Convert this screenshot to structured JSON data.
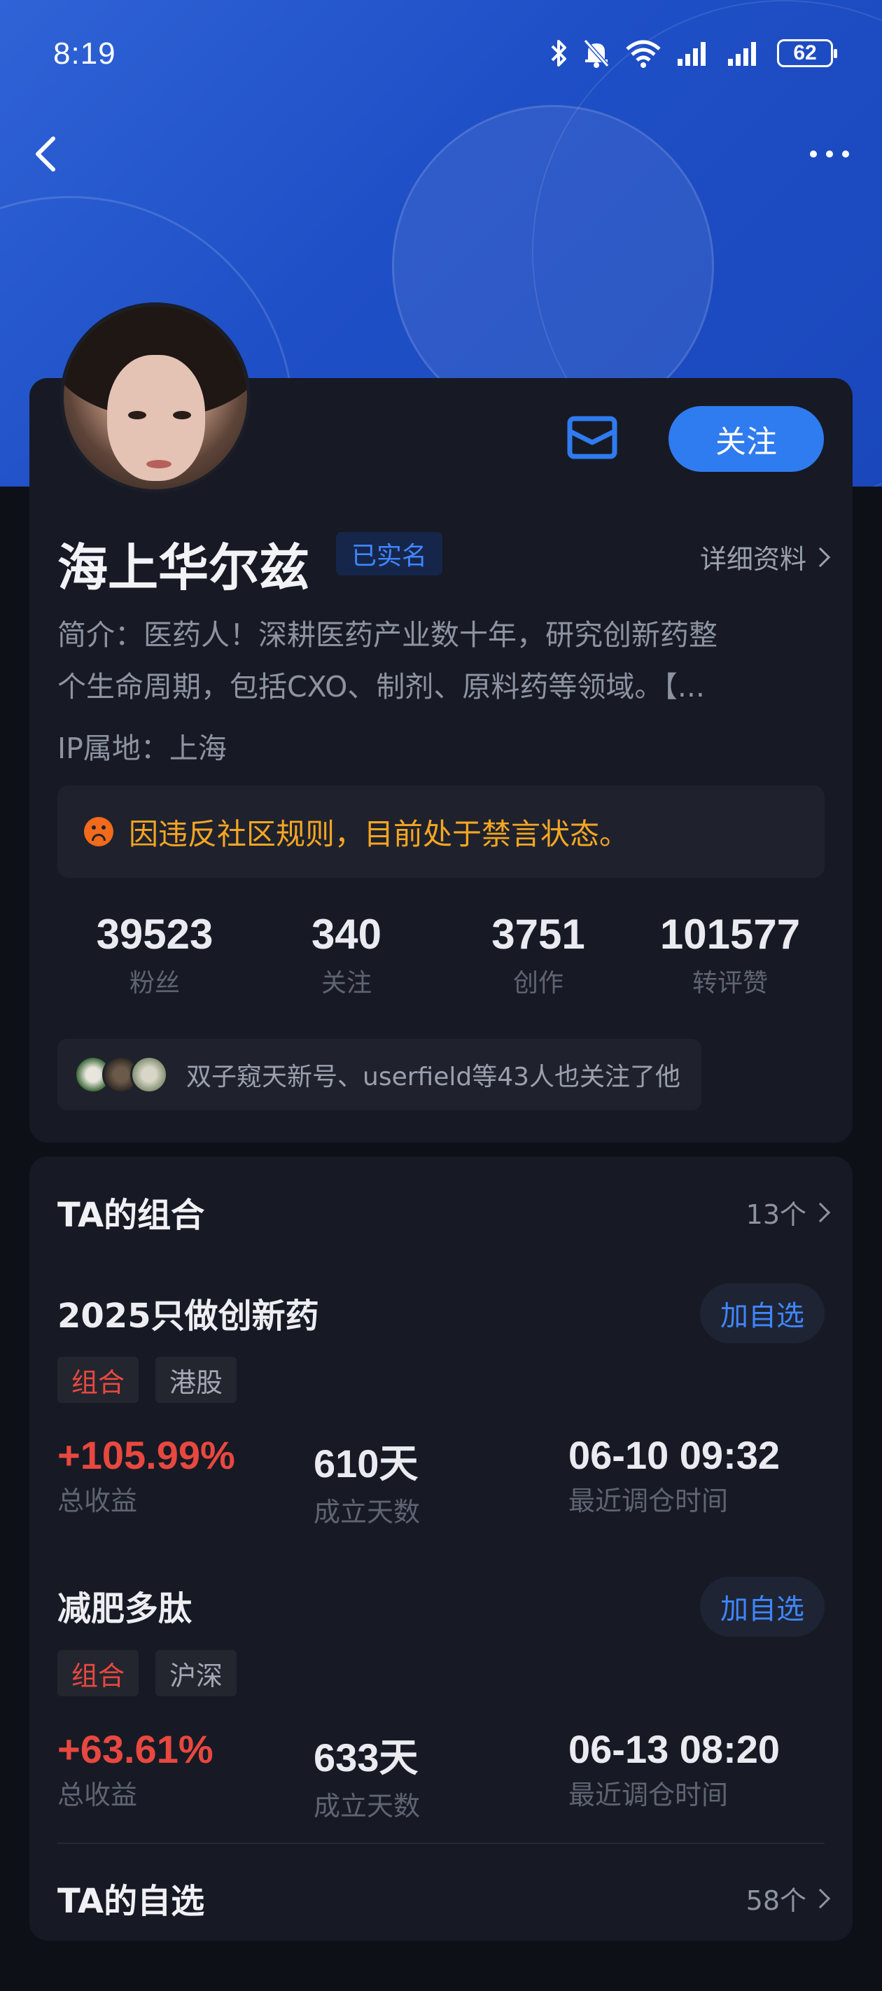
{
  "status_bar": {
    "time": "8:19",
    "battery": "62"
  },
  "profile": {
    "name": "海上华尔兹",
    "verified_badge": "已实名",
    "detail_link": "详细资料",
    "follow_button": "关注",
    "bio_line1": "简介：医药人！深耕医药产业数十年，研究创新药整",
    "bio_line2": "个生命周期，包括CXO、制剂、原料药等领域。【...",
    "ip_location": "IP属地：上海",
    "ban_notice": "因违反社区规则，目前处于禁言状态。",
    "stats": [
      {
        "value": "39523",
        "label": "粉丝"
      },
      {
        "value": "340",
        "label": "关注"
      },
      {
        "value": "3751",
        "label": "创作"
      },
      {
        "value": "101577",
        "label": "转评赞"
      }
    ],
    "mutual_follow_text": "双子窥天新号、userfield等43人也关注了他"
  },
  "portfolios": {
    "section_title": "TA的组合",
    "count": "13个",
    "items": [
      {
        "title": "2025只做创新药",
        "add_label": "加自选",
        "tag_type": "组合",
        "tag_market": "港股",
        "return_value": "+105.99%",
        "return_label": "总收益",
        "days_value": "610天",
        "days_label": "成立天数",
        "rebalance_value": "06-10 09:32",
        "rebalance_label": "最近调仓时间"
      },
      {
        "title": "减肥多肽",
        "add_label": "加自选",
        "tag_type": "组合",
        "tag_market": "沪深",
        "return_value": "+63.61%",
        "return_label": "总收益",
        "days_value": "633天",
        "days_label": "成立天数",
        "rebalance_value": "06-13 08:20",
        "rebalance_label": "最近调仓时间"
      }
    ]
  },
  "watchlist": {
    "section_title": "TA的自选",
    "count": "58个"
  },
  "colors": {
    "accent": "#2f7bf0",
    "rise": "#e8483f",
    "warning": "#f5a623",
    "card": "#171a24",
    "background": "#0e1018"
  }
}
